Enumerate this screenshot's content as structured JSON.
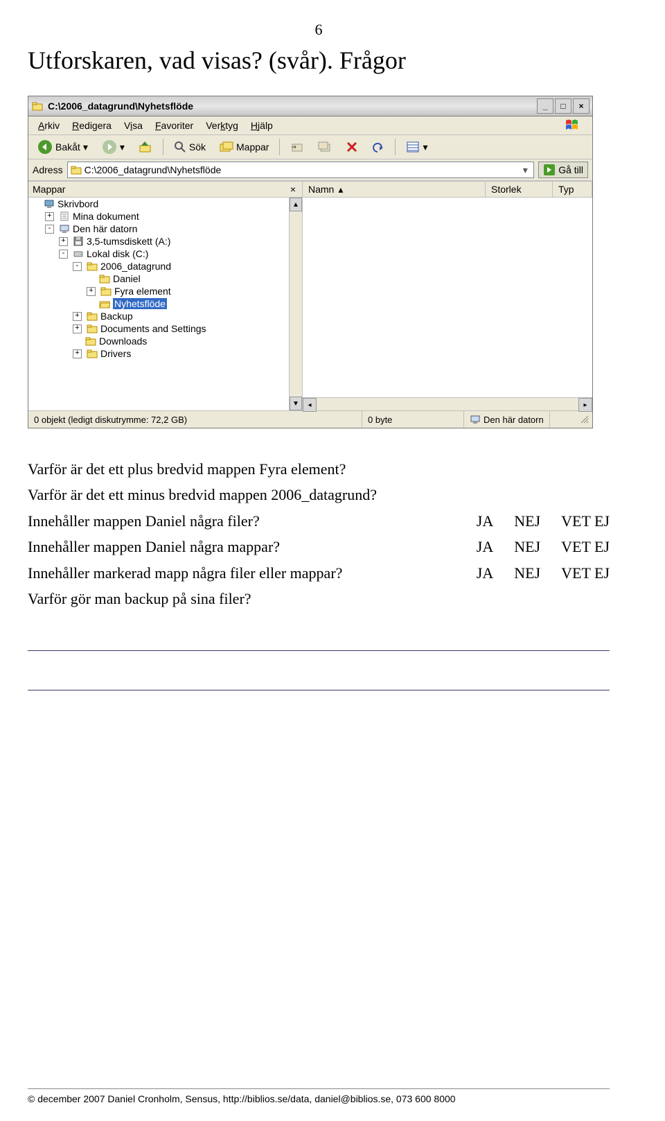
{
  "page_number": "6",
  "title": "Utforskaren, vad visas? (svår). Frågor",
  "window": {
    "title": "C:\\2006_datagrund\\Nyhetsflöde",
    "menus": [
      "Arkiv",
      "Redigera",
      "Visa",
      "Favoriter",
      "Verktyg",
      "Hjälp"
    ],
    "menus_underline_idx": [
      0,
      0,
      0,
      0,
      3,
      0
    ],
    "toolbar": {
      "back": "Bakåt",
      "search": "Sök",
      "folders": "Mappar"
    },
    "address_label": "Adress",
    "address_value": "C:\\2006_datagrund\\Nyhetsflöde",
    "go_label": "Gå till",
    "left_header": "Mappar",
    "tree": [
      {
        "indent": 0,
        "pm": "",
        "icon": "desktop",
        "label": "Skrivbord"
      },
      {
        "indent": 1,
        "pm": "+",
        "icon": "mydocs",
        "label": "Mina dokument"
      },
      {
        "indent": 1,
        "pm": "-",
        "icon": "computer",
        "label": "Den här datorn"
      },
      {
        "indent": 2,
        "pm": "+",
        "icon": "floppy",
        "label": "3,5-tumsdiskett (A:)"
      },
      {
        "indent": 2,
        "pm": "-",
        "icon": "disk",
        "label": "Lokal disk (C:)"
      },
      {
        "indent": 3,
        "pm": "-",
        "icon": "folder",
        "label": "2006_datagrund"
      },
      {
        "indent": 4,
        "pm": "",
        "icon": "folder",
        "label": "Daniel"
      },
      {
        "indent": 4,
        "pm": "+",
        "icon": "folder",
        "label": "Fyra element"
      },
      {
        "indent": 4,
        "pm": "",
        "icon": "folder-open",
        "label": "Nyhetsflöde",
        "selected": true
      },
      {
        "indent": 3,
        "pm": "+",
        "icon": "folder",
        "label": "Backup"
      },
      {
        "indent": 3,
        "pm": "+",
        "icon": "folder",
        "label": "Documents and Settings"
      },
      {
        "indent": 3,
        "pm": "",
        "icon": "folder",
        "label": "Downloads"
      },
      {
        "indent": 3,
        "pm": "+",
        "icon": "folder",
        "label": "Drivers"
      }
    ],
    "cols": {
      "name": "Namn",
      "size": "Storlek",
      "type": "Typ"
    },
    "status": {
      "left": "0 objekt (ledigt diskutrymme: 72,2 GB)",
      "mid": "0 byte",
      "right": "Den här datorn"
    }
  },
  "questions": {
    "q1": "Varför är det ett plus bredvid mappen Fyra element?",
    "q2": "Varför är det ett minus bredvid mappen 2006_datagrund?",
    "q3": "Innehåller mappen Daniel några filer?",
    "q4": "Innehåller mappen Daniel några mappar?",
    "q5": "Innehåller markerad mapp några filer eller mappar?",
    "q6": "Varför gör man backup på sina filer?",
    "opts": {
      "ja": "JA",
      "nej": "NEJ",
      "vetej": "VET EJ"
    }
  },
  "footer": "© december 2007 Daniel Cronholm, Sensus, http://biblios.se/data, daniel@biblios.se, 073 600 8000"
}
